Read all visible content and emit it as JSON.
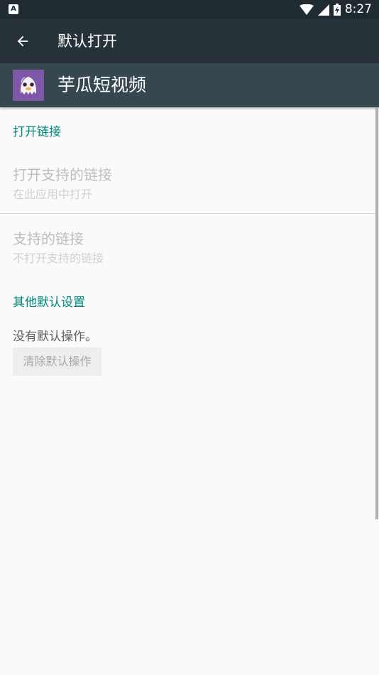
{
  "status_bar": {
    "notification_glyph": "A",
    "time": "8:27",
    "icons": [
      "wifi-icon",
      "signal-icon",
      "battery-charging-icon"
    ]
  },
  "toolbar": {
    "back_icon": "arrow-left-icon",
    "title": "默认打开"
  },
  "app": {
    "name": "芋瓜短视频",
    "icon": "ghost-app-icon",
    "icon_color": "#7e57a6"
  },
  "sections": {
    "open_links": {
      "header": "打开链接",
      "open_supported": {
        "title": "打开支持的链接",
        "summary": "在此应用中打开"
      },
      "supported_links": {
        "title": "支持的链接",
        "summary": "不打开支持的链接"
      }
    },
    "other_defaults": {
      "header": "其他默认设置",
      "no_default_text": "没有默认操作。",
      "clear_button": "清除默认操作"
    }
  },
  "colors": {
    "status_bar": "#1f2b31",
    "toolbar": "#263238",
    "app_header": "#37474f",
    "accent": "#00897b",
    "background": "#fafafa"
  }
}
